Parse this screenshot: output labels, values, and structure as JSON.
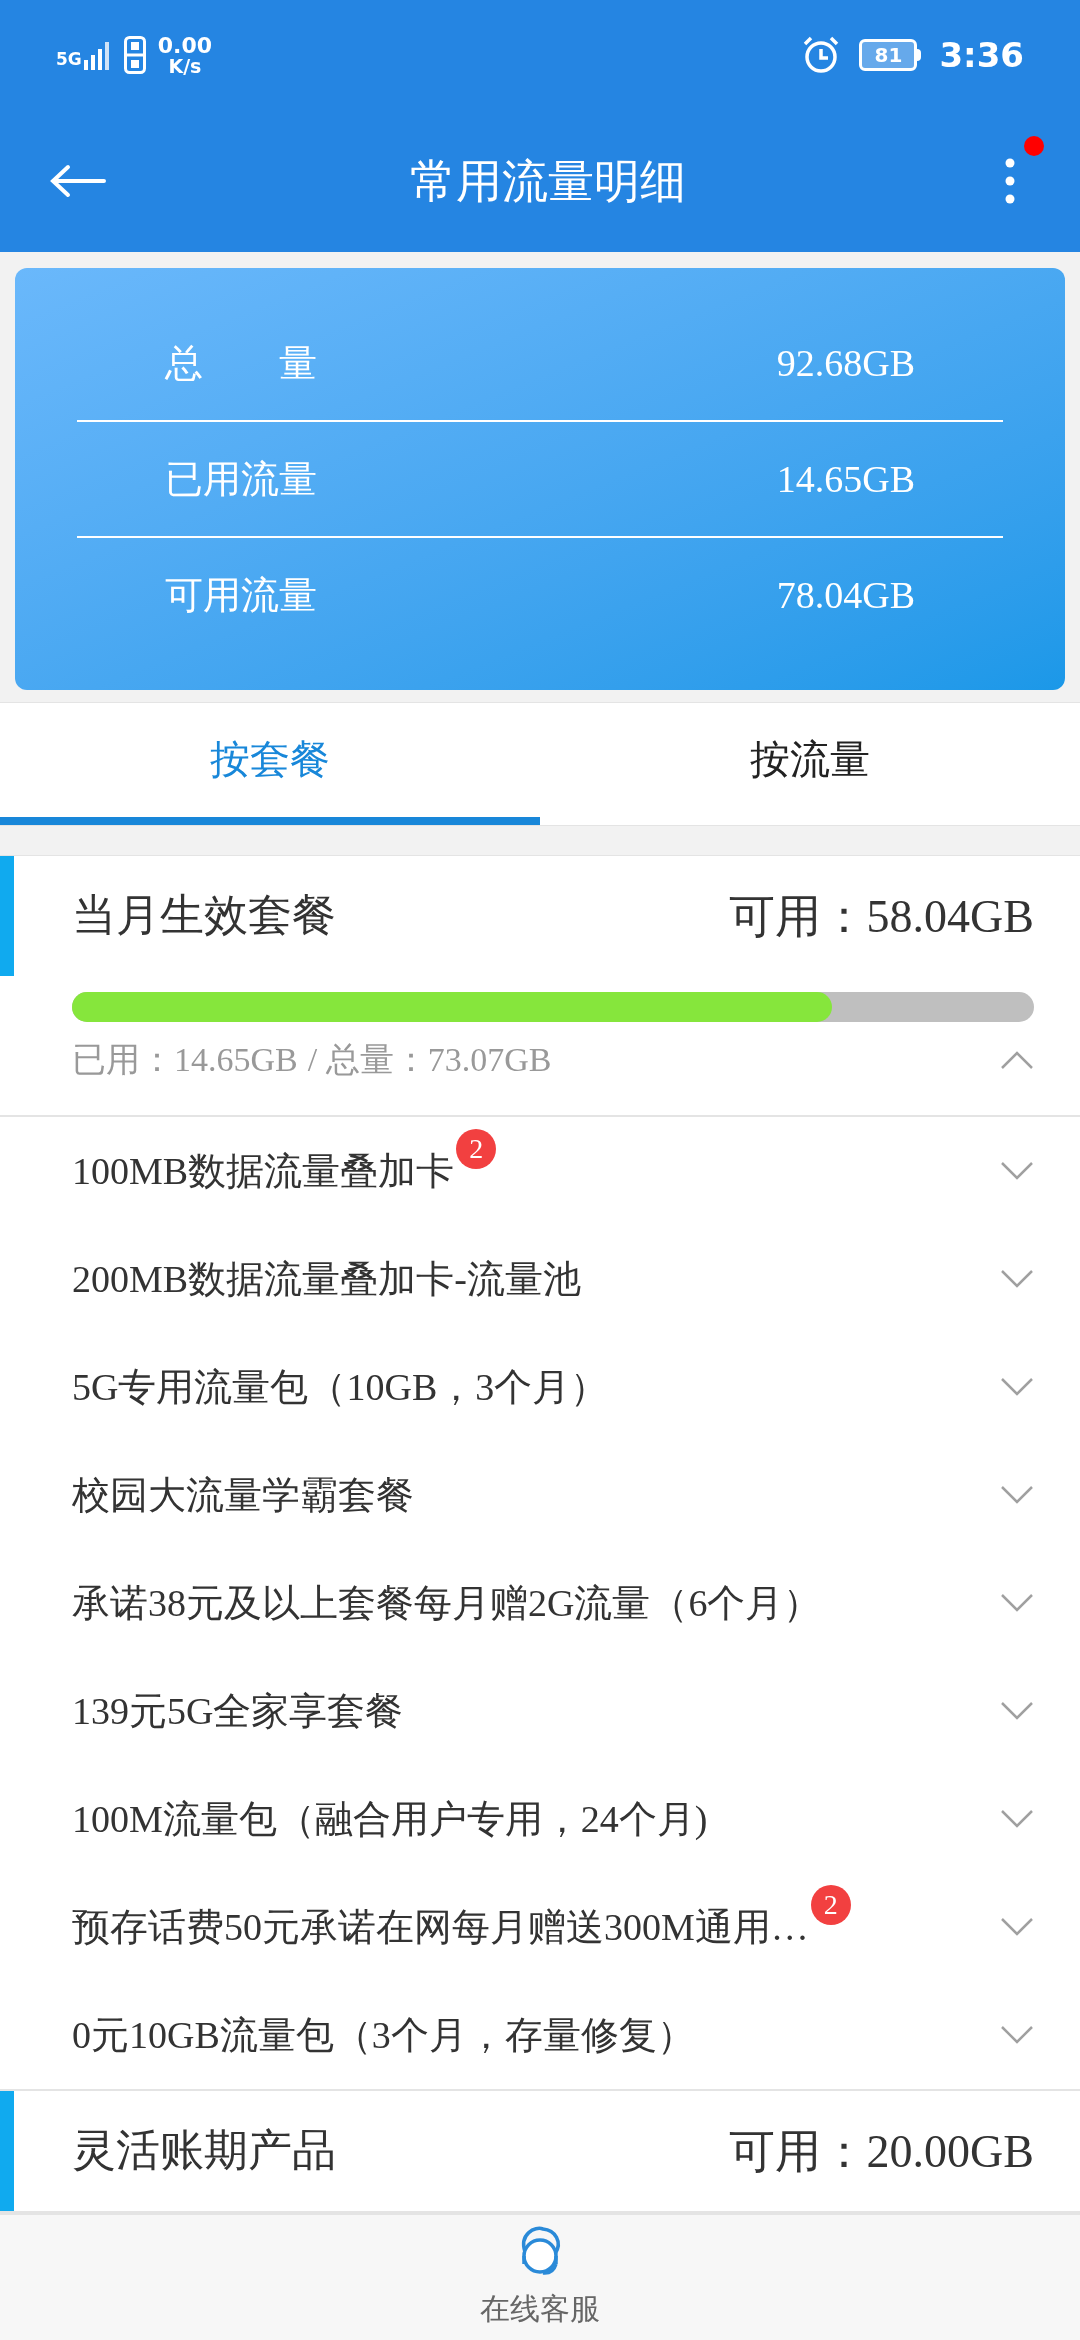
{
  "status_bar": {
    "network": "5G",
    "speed_value": "0.00",
    "speed_unit": "K/s",
    "battery": "81",
    "time": "3:36"
  },
  "header": {
    "title": "常用流量明细",
    "notification_dot": true
  },
  "summary": [
    {
      "label": "总　　量",
      "value": "92.68GB"
    },
    {
      "label": "已用流量",
      "value": "14.65GB"
    },
    {
      "label": "可用流量",
      "value": "78.04GB"
    }
  ],
  "tabs": [
    {
      "label": "按套餐",
      "selected": true
    },
    {
      "label": "按流量",
      "selected": false
    }
  ],
  "sections": [
    {
      "title": "当月生效套餐",
      "available": "可用：58.04GB",
      "level": 0.79,
      "used": "已用：14.65GB",
      "total": "/ 总量：73.07GB",
      "expanded": true,
      "items": [
        {
          "name": "100MB数据流量叠加卡",
          "badge": "2",
          "expanded": false
        },
        {
          "name": "200MB数据流量叠加卡-流量池",
          "expanded": false
        },
        {
          "name": "5G专用流量包（10GB，3个月）",
          "expanded": false
        },
        {
          "name": "校园大流量学霸套餐",
          "expanded": false
        },
        {
          "name": "承诺38元及以上套餐每月赠2G流量（6个月）",
          "expanded": false
        },
        {
          "name": "139元5G全家享套餐",
          "expanded": false
        },
        {
          "name": "100M流量包（融合用户专用，24个月)",
          "expanded": false
        },
        {
          "name": "预存话费50元承诺在网每月赠送300M通用…",
          "badge": "2",
          "expanded": false
        },
        {
          "name": "0元10GB流量包（3个月，存量修复）",
          "expanded": false
        }
      ]
    },
    {
      "title": "灵活账期产品",
      "available": "可用：20.00GB"
    }
  ],
  "bottom_bar": {
    "label": "在线客服"
  }
}
